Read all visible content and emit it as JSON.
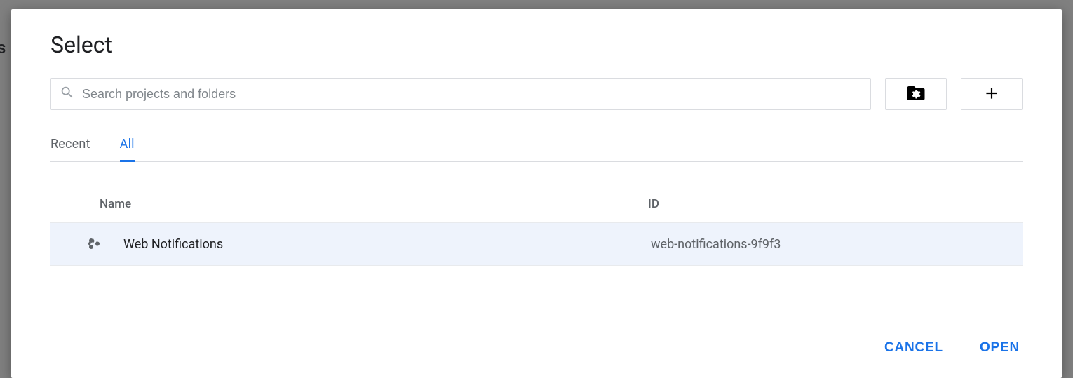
{
  "dialog": {
    "title": "Select",
    "search_placeholder": "Search projects and folders"
  },
  "tabs": {
    "recent": "Recent",
    "all": "All",
    "active": "all"
  },
  "table": {
    "headers": {
      "name": "Name",
      "id": "ID"
    },
    "rows": [
      {
        "name": "Web Notifications",
        "id": "web-notifications-9f9f3"
      }
    ]
  },
  "footer": {
    "cancel": "CANCEL",
    "open": "OPEN"
  }
}
